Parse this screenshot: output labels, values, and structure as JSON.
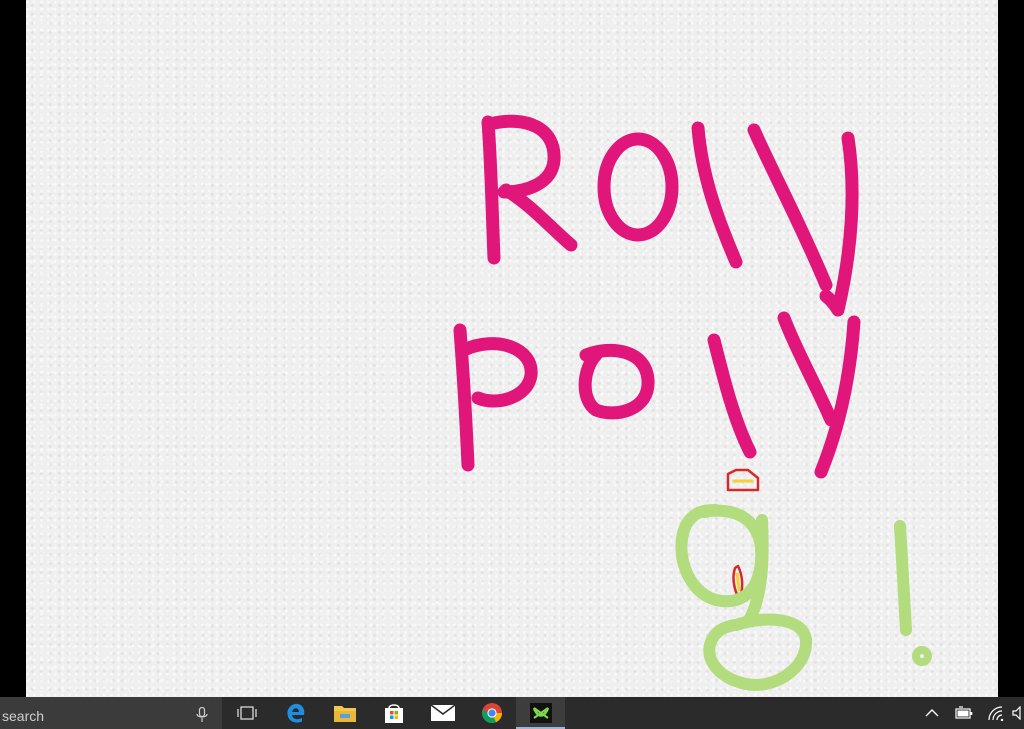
{
  "canvas": {
    "ink_colors": {
      "pink": "#e0167a",
      "green": "#b2dc7e",
      "red": "#d52a2a",
      "yellow": "#f4d235"
    },
    "handwriting_lines": [
      "Roly",
      "poly",
      "g!"
    ]
  },
  "taskbar": {
    "search": {
      "text": "search",
      "icon": "microphone-icon"
    },
    "buttons": [
      {
        "name": "task-view",
        "icon": "task-view-icon"
      },
      {
        "name": "edge",
        "icon": "edge-icon"
      },
      {
        "name": "file-explorer",
        "icon": "folder-icon"
      },
      {
        "name": "store",
        "icon": "store-icon"
      },
      {
        "name": "mail",
        "icon": "mail-icon"
      },
      {
        "name": "chrome",
        "icon": "chrome-icon"
      },
      {
        "name": "paint-app",
        "icon": "paint-app-icon",
        "active": true
      }
    ],
    "tray": [
      "chevron-up-icon",
      "battery-icon",
      "wifi-icon",
      "volume-icon"
    ],
    "accent": "#9bb7d4"
  }
}
